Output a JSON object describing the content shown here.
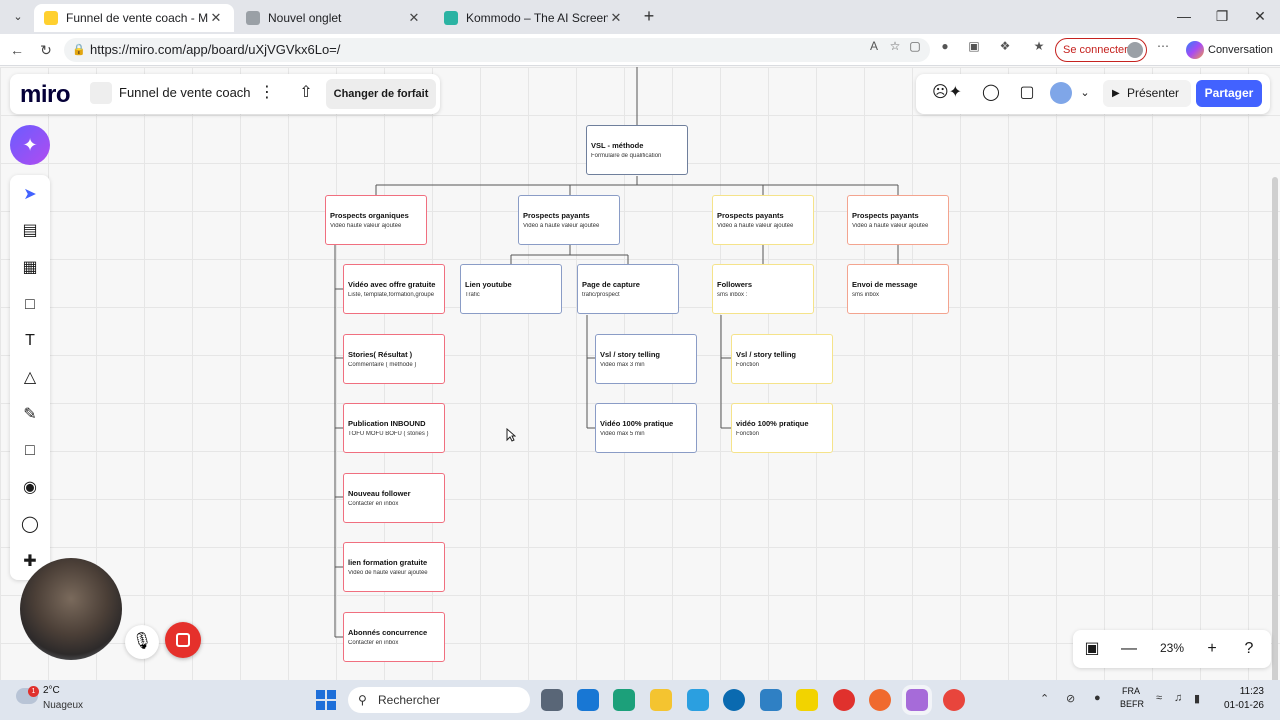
{
  "browser": {
    "tabs": [
      {
        "label": "Funnel de vente coach - Miro",
        "active": true,
        "icon_color": "#ffd02f"
      },
      {
        "label": "Nouvel onglet",
        "active": false,
        "icon_color": "#9aa0a6"
      },
      {
        "label": "Kommodo – The AI Screen Record",
        "active": false,
        "icon_color": "#2bb3a3"
      }
    ],
    "url": "https://miro.com/app/board/uXjVGVkx6Lo=/",
    "signin_label": "Se connecter",
    "copilot_label": "Conversation"
  },
  "miro": {
    "logo": "miro",
    "board_name": "Funnel de vente coach",
    "change_plan_label": "Changer de forfait",
    "present_label": "Présenter",
    "share_label": "Partager",
    "zoom_level": "23%",
    "brand_color": "#4262ff"
  },
  "mindmap": {
    "root": {
      "title": "VSL - méthode",
      "subtitle": "Formulaire de qualification"
    },
    "branches": [
      {
        "title": "Prospects organiques",
        "subtitle": "Vidéo haute valeur ajoutée",
        "children": [
          {
            "title": "Vidéo avec offre gratuite",
            "subtitle": "Liste, template,formation,groupe"
          },
          {
            "title": "Stories( Résultat )",
            "subtitle": "Commentaire ( méthode )"
          },
          {
            "title": "Publication INBOUND",
            "subtitle": "TOFU MOFU BOFU ( stories )"
          },
          {
            "title": "Nouveau follower",
            "subtitle": "Contacter en inbox"
          },
          {
            "title": "lien formation gratuite",
            "subtitle": "Vidéo de haute valeur ajoutée"
          },
          {
            "title": "Abonnés concurrence",
            "subtitle": "Contacter en inbox"
          }
        ]
      },
      {
        "title": "Prospects payants",
        "subtitle": "Vidéo à haute valeur ajoutée",
        "children": [
          {
            "title": "Lien youtube",
            "subtitle": "Trafic"
          },
          {
            "title": "Page de capture",
            "subtitle": "trafic/prospect",
            "children": [
              {
                "title": "Vsl / story telling",
                "subtitle": "Vidéo max 3 min"
              },
              {
                "title": "Vidéo 100% pratique",
                "subtitle": "Vidéo max 5 min"
              }
            ]
          }
        ]
      },
      {
        "title": "Prospects payants",
        "subtitle": "Vidéo à haute valeur ajoutée",
        "children": [
          {
            "title": "Followers",
            "subtitle": "sms inbox :",
            "children": [
              {
                "title": "Vsl / story telling",
                "subtitle": "Fonction"
              },
              {
                "title": "vidéo 100% pratique",
                "subtitle": "Fonction"
              }
            ]
          }
        ]
      },
      {
        "title": "Prospects payants",
        "subtitle": "Vidéo à haute valeur ajoutée",
        "children": [
          {
            "title": "Envoi de message",
            "subtitle": "sms inbox"
          }
        ]
      }
    ]
  },
  "taskbar": {
    "weather_temp": "2°C",
    "weather_desc": "Nuageux",
    "weather_badge": "1",
    "search_placeholder": "Rechercher",
    "lang_top": "FRA",
    "lang_bottom": "BEFR",
    "time": "11:23",
    "date": "01-01-26"
  }
}
